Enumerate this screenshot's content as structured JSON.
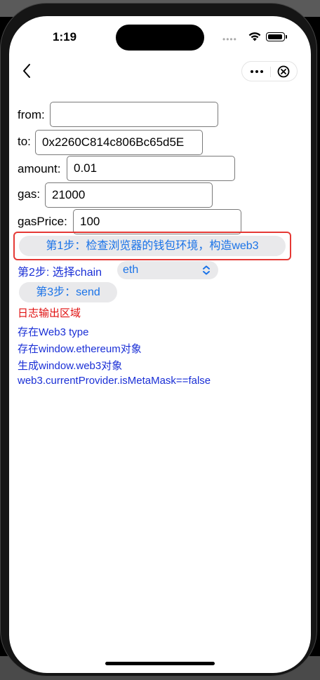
{
  "status_bar": {
    "time": "1:19",
    "signal_icon": "cellular-dots-icon",
    "wifi_icon": "wifi-icon",
    "battery_icon": "battery-icon"
  },
  "nav": {
    "back_icon": "chevron-left-icon",
    "more_icon": "ellipsis-icon",
    "close_icon": "circle-close-icon"
  },
  "form": {
    "from": {
      "label": "from:",
      "value": ""
    },
    "to": {
      "label": "to:",
      "value": "0x2260C814c806Bc65d5E"
    },
    "amount": {
      "label": "amount:",
      "value": "0.01"
    },
    "gas": {
      "label": "gas:",
      "value": "21000"
    },
    "gasPrice": {
      "label": "gasPrice:",
      "value": "100"
    }
  },
  "steps": {
    "step1_label": "第1步：检查浏览器的钱包环境，构造web3",
    "step2_label": "第2步: 选择chain",
    "chain_value": "eth",
    "step3_label": "第3步：send"
  },
  "log": {
    "title": "日志输出区域",
    "lines": [
      "存在Web3 type",
      "存在window.ethereum对象",
      "生成window.web3对象",
      "web3.currentProvider.isMetaMask==false"
    ]
  },
  "colors": {
    "highlight_border": "#e53935",
    "button_text": "#1a73e8",
    "log_title": "#e01010",
    "log_text": "#1a2fd6"
  }
}
